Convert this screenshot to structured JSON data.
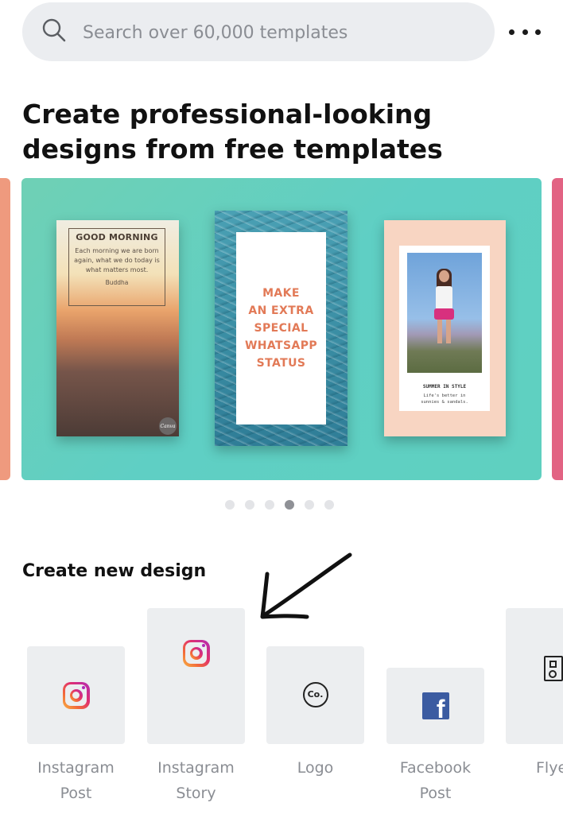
{
  "search": {
    "placeholder": "Search over 60,000 templates"
  },
  "header": {
    "more_icon": "more-horizontal-icon"
  },
  "headline": "Create professional-looking designs from free templates",
  "carousel": {
    "background_color": "#5fcfc0",
    "slides": [
      {
        "title": "GOOD MORNING",
        "text": "Each morning we are born again, what we do today is what matters most.",
        "author": "Buddha",
        "badge": "Canva"
      },
      {
        "text": "MAKE\nAN EXTRA\nSPECIAL\nWHATSAPP\nSTATUS"
      },
      {
        "title": "SUMMER IN STYLE",
        "text": "Life's better in\nsunnies & sandals."
      }
    ],
    "dot_count": 6,
    "active_dot": 3
  },
  "create_section": {
    "title": "Create new design",
    "tiles": [
      {
        "label": "Instagram\nPost",
        "icon": "instagram-icon"
      },
      {
        "label": "Instagram\nStory",
        "icon": "instagram-icon"
      },
      {
        "label": "Logo",
        "icon": "logo-co-icon",
        "icon_text": "Co."
      },
      {
        "label": "Facebook\nPost",
        "icon": "facebook-icon",
        "icon_text": "f"
      },
      {
        "label": "Flye",
        "icon": "flyer-icon"
      }
    ]
  },
  "colors": {
    "accent_left_peek": "#ef9a7e",
    "accent_right_peek": "#e26383",
    "tile_bg": "#eceef0",
    "label_gray": "#8a8d93",
    "facebook_blue": "#3b5ba1"
  }
}
